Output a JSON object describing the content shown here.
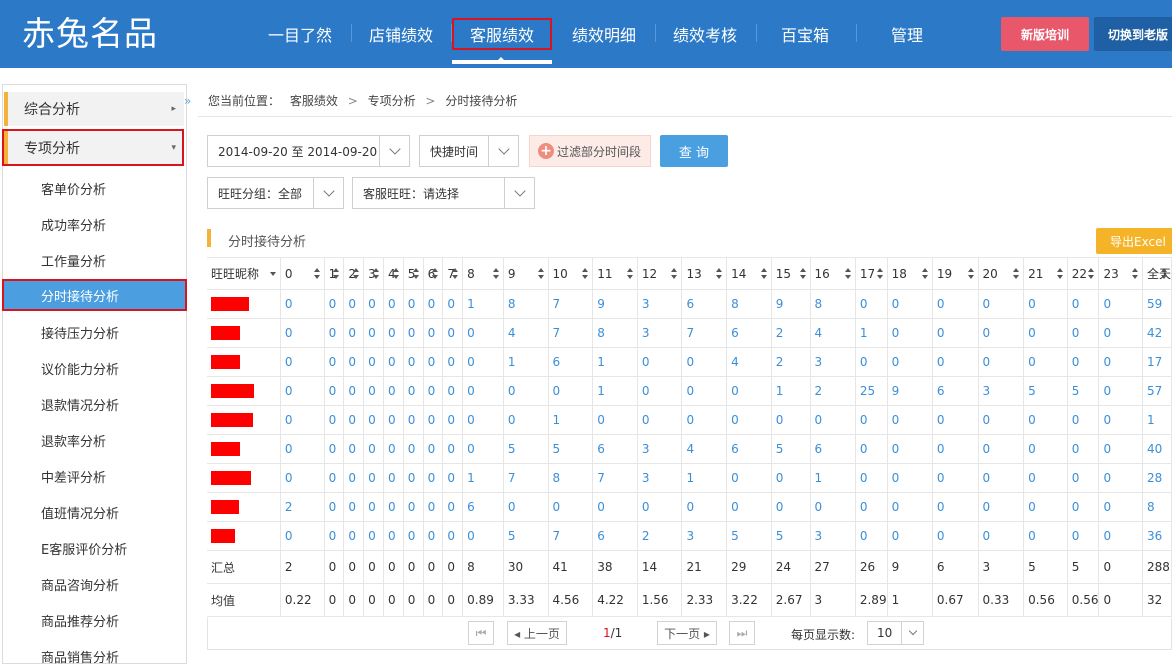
{
  "logo": "赤兔名品",
  "nav": [
    "一目了然",
    "店铺绩效",
    "客服绩效",
    "绩效明细",
    "绩效考核",
    "百宝箱",
    "管理"
  ],
  "header_buttons": {
    "training": "新版培训",
    "switch_old": "切换到老版"
  },
  "sidebar": {
    "collapse": "»",
    "groups": [
      {
        "label": "综合分析",
        "arrow": "▸"
      },
      {
        "label": "专项分析",
        "arrow": "▾"
      }
    ],
    "items": [
      "客单价分析",
      "成功率分析",
      "工作量分析",
      "分时接待分析",
      "接待压力分析",
      "议价能力分析",
      "退款情况分析",
      "退款率分析",
      "中差评分析",
      "值班情况分析",
      "E客服评价分析",
      "商品咨询分析",
      "商品推荐分析",
      "商品销售分析"
    ],
    "active_index": 3
  },
  "breadcrumb": {
    "prefix": "您当前位置：",
    "path": [
      "客服绩效",
      "专项分析",
      "分时接待分析"
    ],
    "sep": ">"
  },
  "filters": {
    "date_range": "2014-09-20 至 2014-09-20",
    "quick_time": "快捷时间",
    "filter_periods": "过滤部分时间段",
    "query": "查 询",
    "group": "旺旺分组：全部",
    "service": "客服旺旺：请选择"
  },
  "section": {
    "title": "分时接待分析",
    "export": "导出Excel"
  },
  "table": {
    "name_header": "旺旺昵称",
    "hours": [
      "0",
      "1",
      "2",
      "3",
      "4",
      "5",
      "6",
      "7",
      "8",
      "9",
      "10",
      "11",
      "12",
      "13",
      "14",
      "15",
      "16",
      "17",
      "18",
      "19",
      "20",
      "21",
      "22",
      "23",
      "全天"
    ],
    "rows": [
      {
        "redact_width": 38,
        "values": [
          "0",
          "0",
          "0",
          "0",
          "0",
          "0",
          "0",
          "0",
          "1",
          "8",
          "7",
          "9",
          "3",
          "6",
          "8",
          "9",
          "8",
          "0",
          "0",
          "0",
          "0",
          "0",
          "0",
          "0",
          "59"
        ]
      },
      {
        "redact_width": 29,
        "values": [
          "0",
          "0",
          "0",
          "0",
          "0",
          "0",
          "0",
          "0",
          "0",
          "4",
          "7",
          "8",
          "3",
          "7",
          "6",
          "2",
          "4",
          "1",
          "0",
          "0",
          "0",
          "0",
          "0",
          "0",
          "42"
        ]
      },
      {
        "redact_width": 29,
        "values": [
          "0",
          "0",
          "0",
          "0",
          "0",
          "0",
          "0",
          "0",
          "0",
          "1",
          "6",
          "1",
          "0",
          "0",
          "4",
          "2",
          "3",
          "0",
          "0",
          "0",
          "0",
          "0",
          "0",
          "0",
          "17"
        ]
      },
      {
        "redact_width": 43,
        "values": [
          "0",
          "0",
          "0",
          "0",
          "0",
          "0",
          "0",
          "0",
          "0",
          "0",
          "0",
          "1",
          "0",
          "0",
          "0",
          "1",
          "2",
          "25",
          "9",
          "6",
          "3",
          "5",
          "5",
          "0",
          "57"
        ]
      },
      {
        "redact_width": 42,
        "values": [
          "0",
          "0",
          "0",
          "0",
          "0",
          "0",
          "0",
          "0",
          "0",
          "0",
          "1",
          "0",
          "0",
          "0",
          "0",
          "0",
          "0",
          "0",
          "0",
          "0",
          "0",
          "0",
          "0",
          "0",
          "1"
        ]
      },
      {
        "redact_width": 29,
        "values": [
          "0",
          "0",
          "0",
          "0",
          "0",
          "0",
          "0",
          "0",
          "0",
          "5",
          "5",
          "6",
          "3",
          "4",
          "6",
          "5",
          "6",
          "0",
          "0",
          "0",
          "0",
          "0",
          "0",
          "0",
          "40"
        ]
      },
      {
        "redact_width": 40,
        "values": [
          "0",
          "0",
          "0",
          "0",
          "0",
          "0",
          "0",
          "0",
          "1",
          "7",
          "8",
          "7",
          "3",
          "1",
          "0",
          "0",
          "1",
          "0",
          "0",
          "0",
          "0",
          "0",
          "0",
          "0",
          "28"
        ]
      },
      {
        "redact_width": 28,
        "values": [
          "2",
          "0",
          "0",
          "0",
          "0",
          "0",
          "0",
          "0",
          "6",
          "0",
          "0",
          "0",
          "0",
          "0",
          "0",
          "0",
          "0",
          "0",
          "0",
          "0",
          "0",
          "0",
          "0",
          "0",
          "8"
        ]
      },
      {
        "redact_width": 24,
        "values": [
          "0",
          "0",
          "0",
          "0",
          "0",
          "0",
          "0",
          "0",
          "0",
          "5",
          "7",
          "6",
          "2",
          "3",
          "5",
          "5",
          "3",
          "0",
          "0",
          "0",
          "0",
          "0",
          "0",
          "0",
          "36"
        ]
      }
    ],
    "total": {
      "label": "汇总",
      "values": [
        "2",
        "0",
        "0",
        "0",
        "0",
        "0",
        "0",
        "0",
        "8",
        "30",
        "41",
        "38",
        "14",
        "21",
        "29",
        "24",
        "27",
        "26",
        "9",
        "6",
        "3",
        "5",
        "5",
        "0",
        "288"
      ]
    },
    "average": {
      "label": "均值",
      "values": [
        "0.22",
        "0",
        "0",
        "0",
        "0",
        "0",
        "0",
        "0",
        "0.89",
        "3.33",
        "4.56",
        "4.22",
        "1.56",
        "2.33",
        "3.22",
        "2.67",
        "3",
        "2.89",
        "1",
        "0.67",
        "0.33",
        "0.56",
        "0.56",
        "0",
        "32"
      ]
    }
  },
  "pagination": {
    "first": "⏮",
    "prev": "◂ 上一页",
    "current": "1",
    "total": "/1",
    "next": "下一页 ▸",
    "last": "⏭",
    "per_page_label": "每页显示数:",
    "per_page": "10"
  }
}
